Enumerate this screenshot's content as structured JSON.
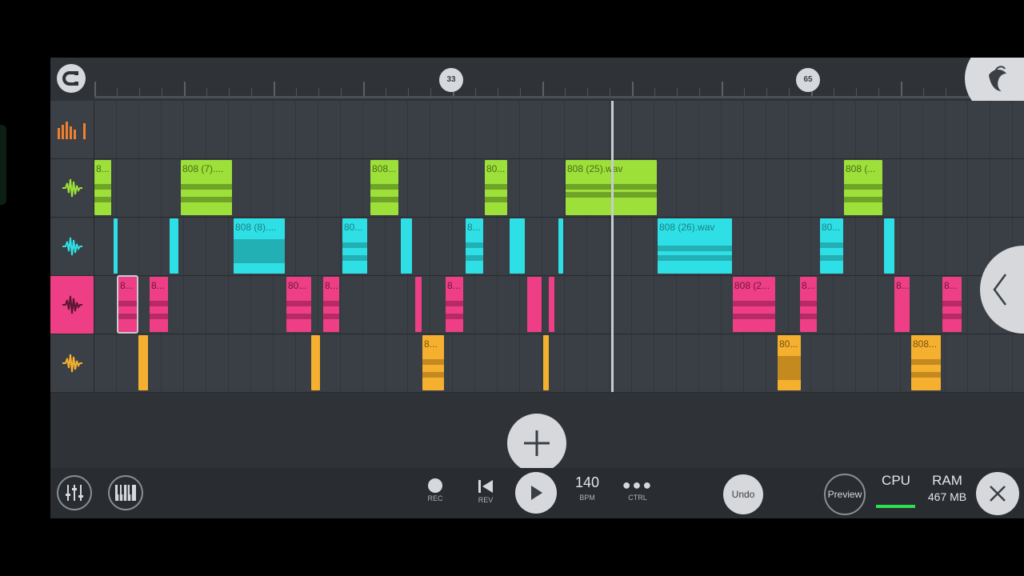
{
  "timeline": {
    "markers": [
      "33",
      "65"
    ]
  },
  "tracks": [
    {
      "name": "automation",
      "color": "#f07f2e",
      "clips": []
    },
    {
      "name": "track-green",
      "color": "#9de03a",
      "clips": [
        {
          "label": "8..."
        },
        {
          "label": "808 (7)...."
        },
        {
          "label": "808..."
        },
        {
          "label": "80..."
        },
        {
          "label": "808 (25).wav"
        },
        {
          "label": "808 (..."
        }
      ]
    },
    {
      "name": "track-cyan",
      "color": "#2ee0e6",
      "clips": [
        {
          "label": ""
        },
        {
          "label": ""
        },
        {
          "label": "808 (8)...."
        },
        {
          "label": "80..."
        },
        {
          "label": ""
        },
        {
          "label": "8..."
        },
        {
          "label": ""
        },
        {
          "label": ""
        },
        {
          "label": "808 (26).wav"
        },
        {
          "label": "80..."
        },
        {
          "label": ""
        }
      ]
    },
    {
      "name": "track-pink",
      "color": "#ee3f86",
      "clips": [
        {
          "label": "8..."
        },
        {
          "label": "8..."
        },
        {
          "label": "80..."
        },
        {
          "label": "8..."
        },
        {
          "label": ""
        },
        {
          "label": "8..."
        },
        {
          "label": ""
        },
        {
          "label": ""
        },
        {
          "label": "808 (2..."
        },
        {
          "label": "8..."
        },
        {
          "label": "8..."
        },
        {
          "label": "8..."
        }
      ]
    },
    {
      "name": "track-orange",
      "color": "#f5b030",
      "clips": [
        {
          "label": ""
        },
        {
          "label": ""
        },
        {
          "label": "8..."
        },
        {
          "label": ""
        },
        {
          "label": "80..."
        },
        {
          "label": "808..."
        }
      ]
    }
  ],
  "transport": {
    "rec_label": "REC",
    "rev_label": "REV",
    "tempo_value": "140",
    "tempo_label": "BPM",
    "ctrl_label": "CTRL",
    "undo_label": "Undo",
    "preview_label": "Preview",
    "cpu_label": "CPU",
    "ram_label": "RAM",
    "ram_value": "467 MB"
  },
  "icons": [
    "magnet-icon",
    "fl-fruit-logo-icon",
    "automation-icon",
    "waveform-icon",
    "add-icon",
    "collapse-arrow-icon",
    "mixer-icon",
    "piano-icon",
    "record-icon",
    "rewind-icon",
    "play-icon",
    "more-icon",
    "close-icon"
  ],
  "colors": {
    "accent": "#ee3f86",
    "cpu_bar": "#2de04e"
  }
}
